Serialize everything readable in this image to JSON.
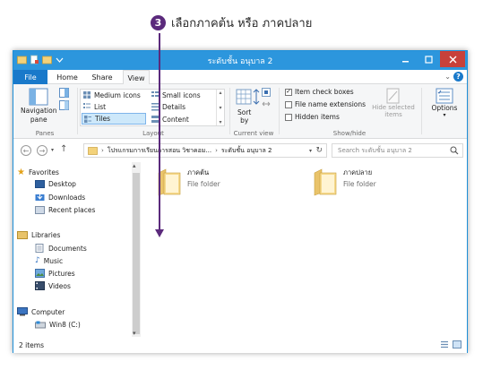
{
  "annotation": {
    "number": "3",
    "text": "เลือกภาคต้น หรือ ภาคปลาย"
  },
  "window": {
    "title": "ระดับชั้น อนุบาล 2"
  },
  "tabs": {
    "file": "File",
    "home": "Home",
    "share": "Share",
    "view": "View"
  },
  "ribbon": {
    "panes": {
      "nav_label_1": "Navigation",
      "nav_label_2": "pane",
      "group": "Panes"
    },
    "layout": {
      "items": [
        "Medium icons",
        "Small icons",
        "List",
        "Details",
        "Tiles",
        "Content"
      ],
      "group": "Layout"
    },
    "current_view": {
      "sort_1": "Sort",
      "sort_2": "by",
      "group": "Current view"
    },
    "show_hide": {
      "item_check_boxes": "Item check boxes",
      "file_name_extensions": "File name extensions",
      "hidden_items": "Hidden items",
      "hide_selected_1": "Hide selected",
      "hide_selected_2": "items",
      "group": "Show/hide"
    },
    "options": "Options"
  },
  "address": {
    "crumbs": [
      "โปรแกรมการเรียนการสอน วิชาคอม...",
      "ระดับชั้น อนุบาล 2"
    ],
    "search_placeholder": "Search ระดับชั้น อนุบาล 2"
  },
  "nav": {
    "favorites": "Favorites",
    "desktop": "Desktop",
    "downloads": "Downloads",
    "recent": "Recent places",
    "libraries": "Libraries",
    "documents": "Documents",
    "music": "Music",
    "pictures": "Pictures",
    "videos": "Videos",
    "computer": "Computer",
    "drive": "Win8 (C:)"
  },
  "items": [
    {
      "name": "ภาคต้น",
      "type": "File folder"
    },
    {
      "name": "ภาคปลาย",
      "type": "File folder"
    }
  ],
  "status": {
    "count": "2 items"
  },
  "colors": {
    "title_bar": "#2c96dd",
    "file_tab": "#1979ca",
    "annotation": "#5b2a7c",
    "close_button": "#c7413a"
  }
}
